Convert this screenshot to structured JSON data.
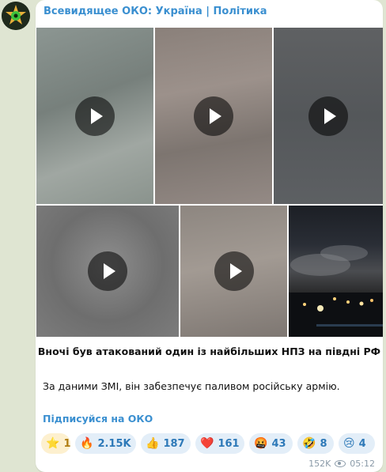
{
  "post": {
    "channel_name": "Всевидящее ОКО: Україна | Політика",
    "headline": "Вночі був атакований один із найбільших НПЗ на півдні РФ",
    "body": "За даними ЗМІ, він забезпечує паливом російську армію.",
    "subscribe_link": "Підписуйся на ОКО",
    "views": "152K",
    "time": "05:12"
  },
  "media": [
    {
      "kind": "video",
      "icon": "play-icon"
    },
    {
      "kind": "video",
      "icon": "play-icon"
    },
    {
      "kind": "video",
      "icon": "play-icon"
    },
    {
      "kind": "video",
      "icon": "play-icon"
    },
    {
      "kind": "video",
      "icon": "play-icon"
    },
    {
      "kind": "photo"
    }
  ],
  "reactions": [
    {
      "emoji": "⭐",
      "count": "1",
      "paid": true
    },
    {
      "emoji": "🔥",
      "count": "2.15K"
    },
    {
      "emoji": "👍",
      "count": "187"
    },
    {
      "emoji": "❤️",
      "count": "161"
    },
    {
      "emoji": "🤬",
      "count": "43"
    },
    {
      "emoji": "🤣",
      "count": "8"
    },
    {
      "emoji": "😢",
      "count": "4"
    }
  ],
  "colors": {
    "accent": "#3a8fd0",
    "chat_background": "#dfe5d2",
    "reaction_bg": "#e3eef8",
    "paid_reaction_bg": "#fdf0cf"
  }
}
